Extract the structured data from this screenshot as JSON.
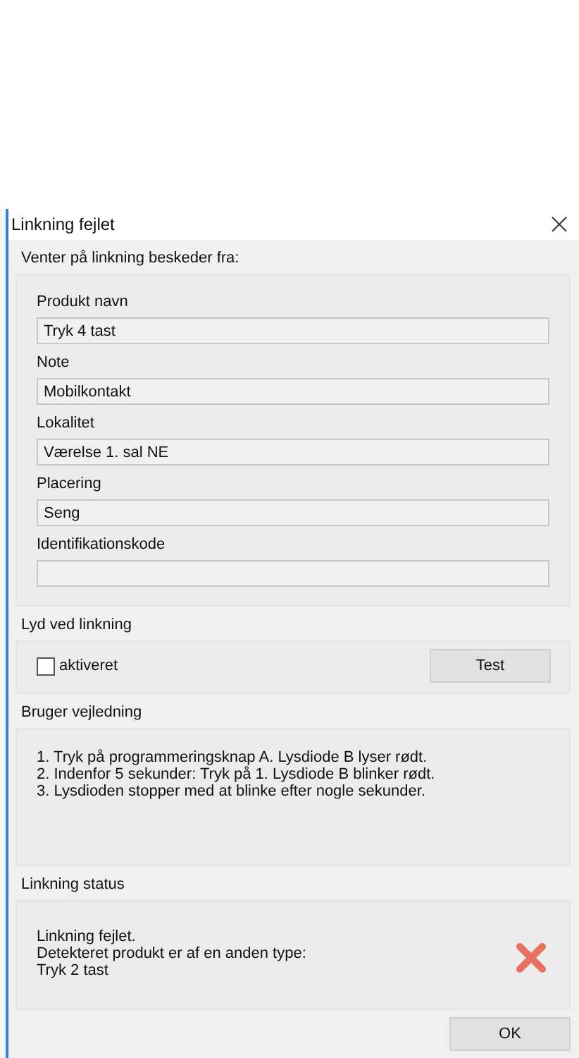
{
  "window": {
    "title": "Linkning fejlet"
  },
  "product_group": {
    "title": "Venter på linkning beskeder fra:",
    "fields": [
      {
        "label": "Produkt navn",
        "value": "Tryk 4 tast"
      },
      {
        "label": "Note",
        "value": "Mobilkontakt"
      },
      {
        "label": "Lokalitet",
        "value": "Værelse 1. sal NE"
      },
      {
        "label": "Placering",
        "value": "Seng"
      },
      {
        "label": "Identifikationskode"
      }
    ]
  },
  "sound_group": {
    "title": "Lyd ved linkning",
    "checkbox": {
      "label": "aktiveret",
      "checked": false
    },
    "button": "Test"
  },
  "guide_group": {
    "title": "Bruger vejledning",
    "lines": [
      "1. Tryk på programmeringsknap A. Lysdiode B lyser rødt.",
      "2. Indenfor 5 sekunder: Tryk på 1. Lysdiode B blinker rødt.",
      "3. Lysdioden stopper med at blinke efter nogle sekunder."
    ]
  },
  "status_group": {
    "title": "Linkning status",
    "failed": true,
    "lines": [
      "Linkning fejlet.",
      "Detekteret produkt er af en anden type:",
      "Tryk 2 tast"
    ]
  },
  "buttons": [
    "OK"
  ]
}
